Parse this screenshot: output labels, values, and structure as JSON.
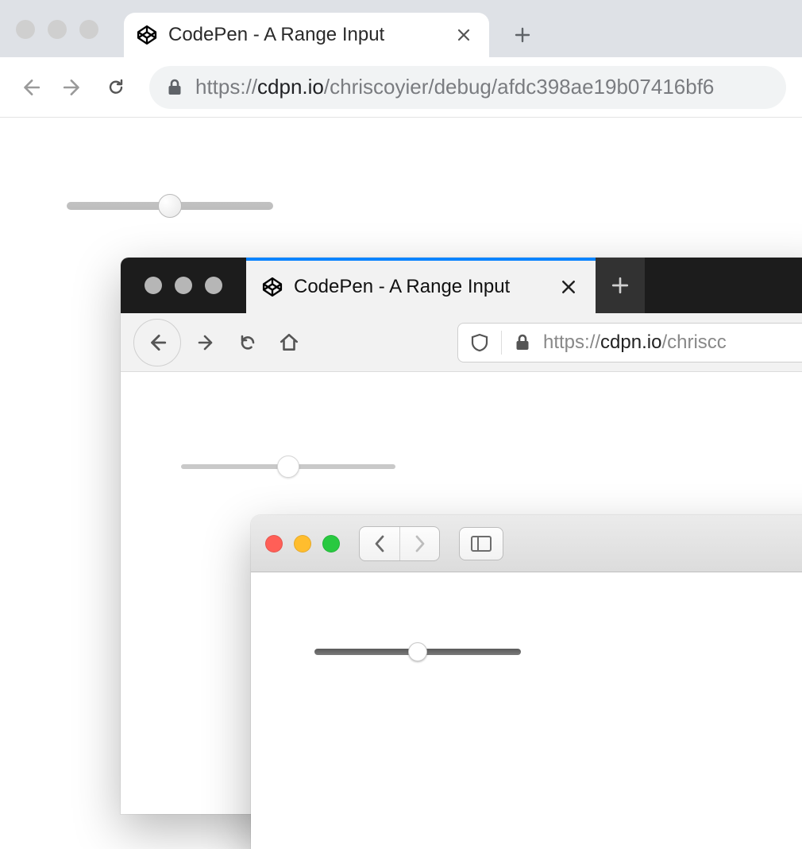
{
  "window1": {
    "tab_title": "CodePen - A Range Input",
    "url_scheme": "https://",
    "url_domain": "cdpn.io",
    "url_path": "/chriscoyier/debug/afdc398ae19b07416bf6",
    "range_value_pct": 50
  },
  "window2": {
    "tab_title": "CodePen - A Range Input",
    "url_scheme": "https://",
    "url_domain": "cdpn.io",
    "url_path": "/chriscc",
    "range_value_pct": 50
  },
  "window3": {
    "range_value_pct": 50
  }
}
